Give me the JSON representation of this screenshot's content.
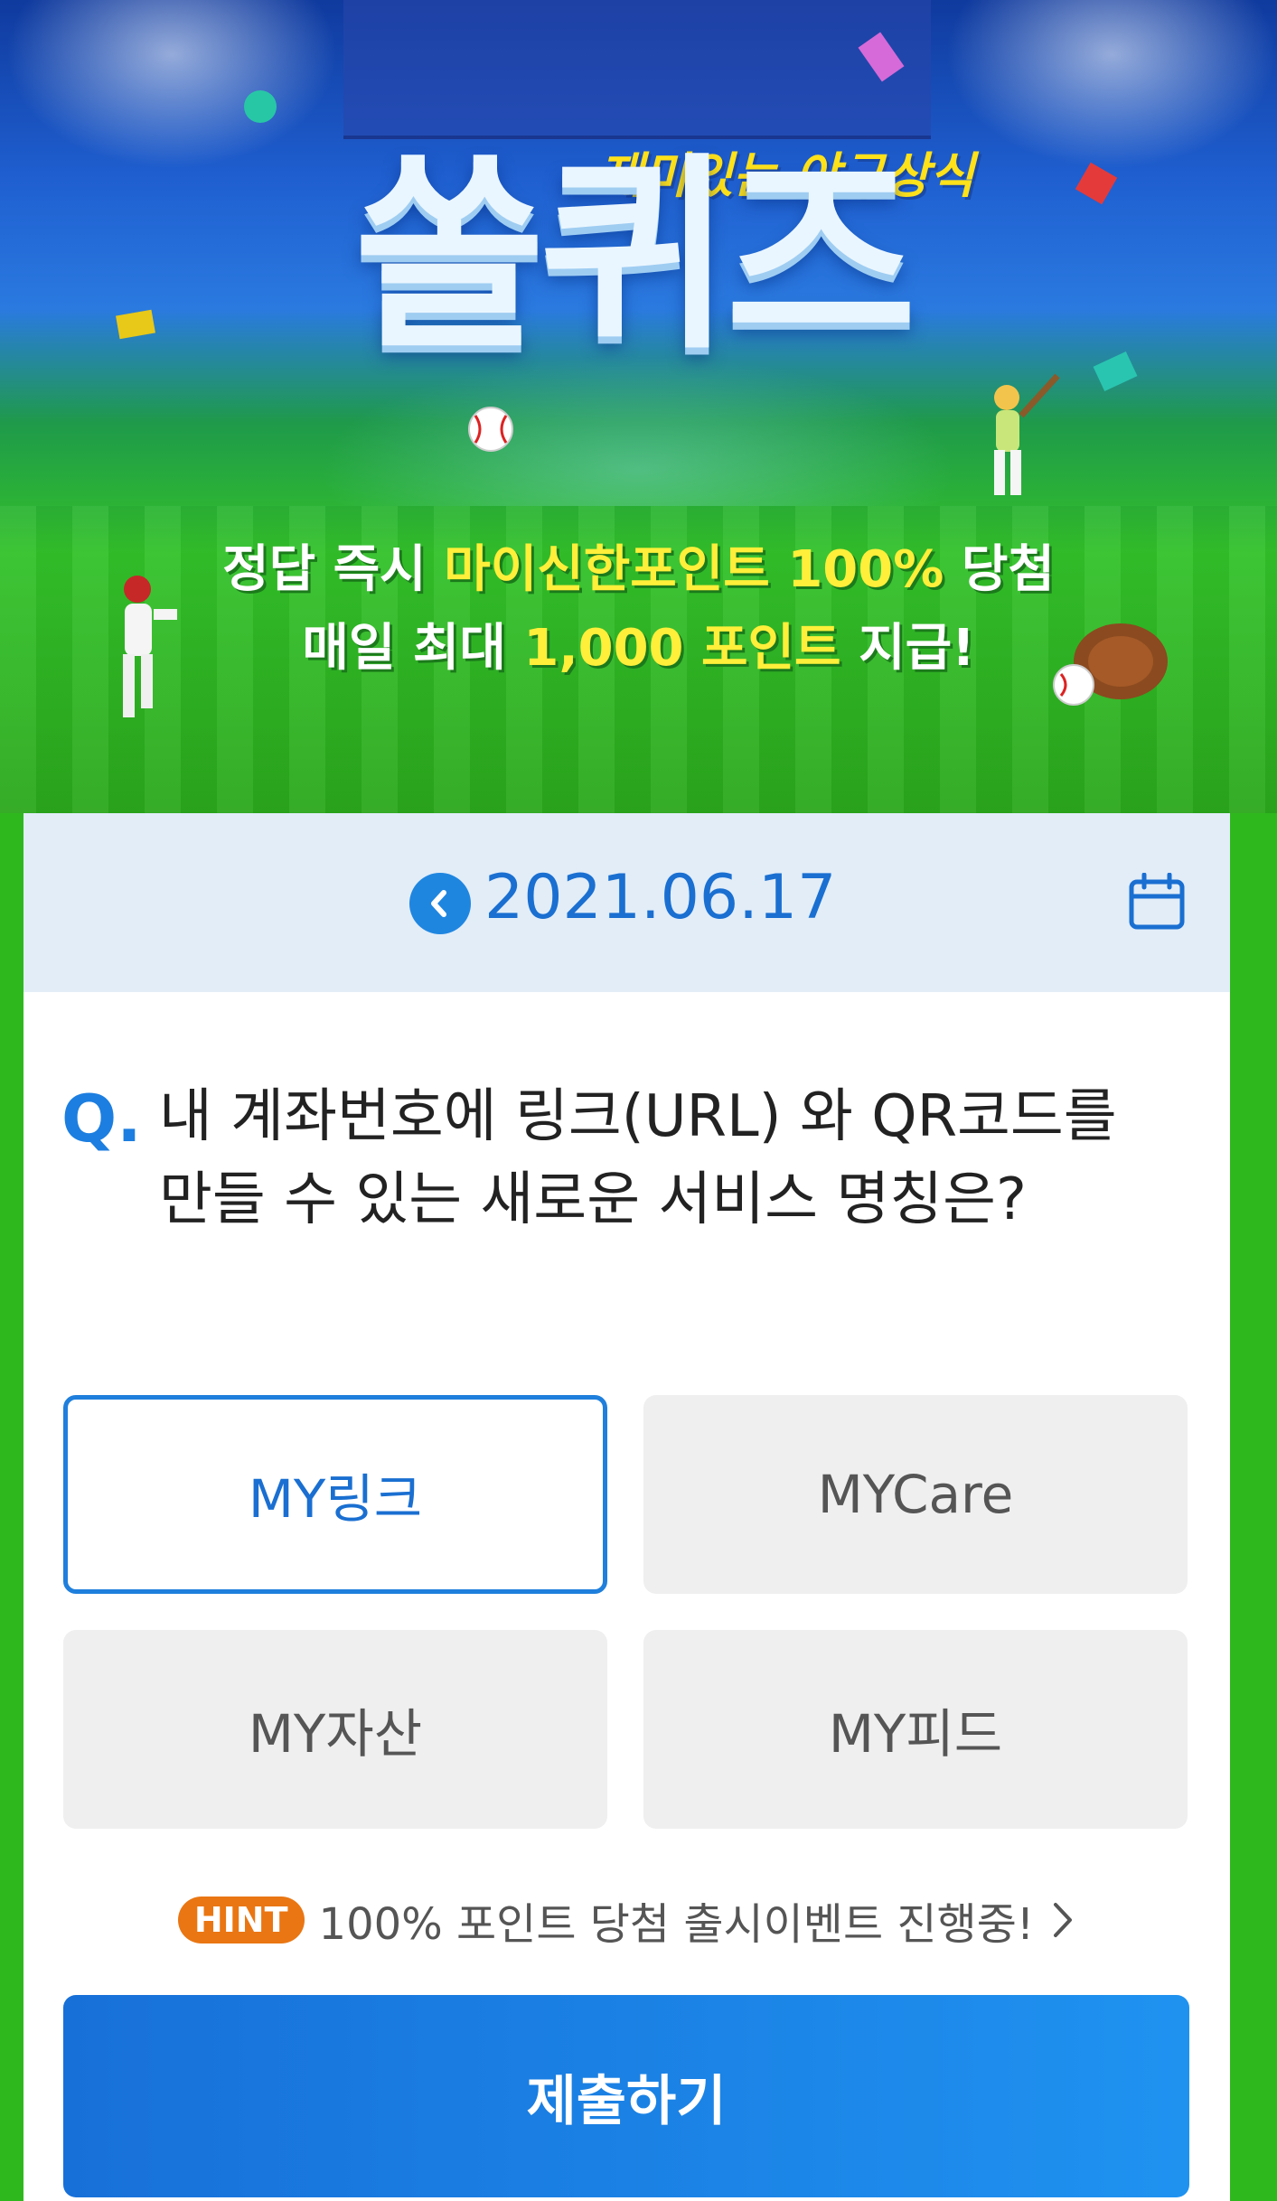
{
  "banner": {
    "subtitle": "재미있는 야구상식",
    "title": "쏠퀴즈",
    "promo_line1_a": "정답 즉시 ",
    "promo_line1_b": "마이신한포인트 100%",
    "promo_line1_c": " 당첨",
    "promo_line2_a": "매일 최대 ",
    "promo_line2_b": "1,000 포인트",
    "promo_line2_c": " 지급!"
  },
  "date_bar": {
    "date": "2021.06.17",
    "prev_icon": "chevron-left-icon",
    "calendar_icon": "calendar-icon"
  },
  "question": {
    "prefix": "Q.",
    "text": "내 계좌번호에 링크(URL) 와 QR코드를 만들 수 있는 새로운 서비스 명칭은?"
  },
  "options": [
    {
      "label": "MY링크",
      "selected": true
    },
    {
      "label": "MYCare",
      "selected": false
    },
    {
      "label": "MY자산",
      "selected": false
    },
    {
      "label": "MY피드",
      "selected": false
    }
  ],
  "hint": {
    "badge": "HINT",
    "text": "100% 포인트 당첨 출시이벤트 진행중!"
  },
  "submit_label": "제출하기",
  "colors": {
    "accent": "#1f7fdc",
    "hint_badge": "#e97613",
    "background_green": "#2fb81e"
  }
}
